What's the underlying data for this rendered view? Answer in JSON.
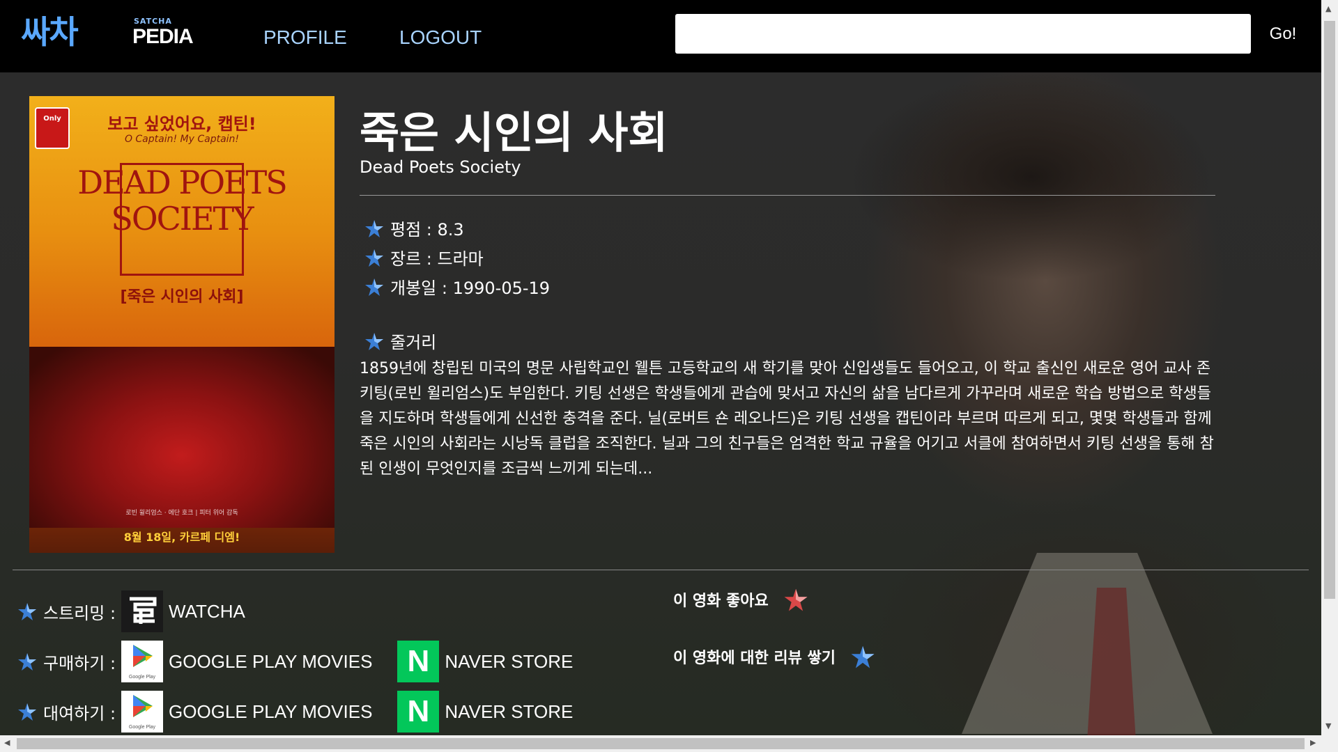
{
  "nav": {
    "logo_main": "싸차",
    "logo_small": "SATCHA",
    "logo_pedia": "PEDIA",
    "profile_label": "PROFILE",
    "logout_label": "LOGOUT",
    "search_value": "",
    "go_label": "Go!"
  },
  "poster": {
    "tag": "Only",
    "line1": "보고 싶었어요, 캡틴!",
    "line2": "O Captain! My Captain!",
    "title": "DEAD POETS SOCIETY",
    "subtitle": "[죽은 시인의 사회]",
    "credits": "로빈 윌리엄스 · 에단 호크 | 피터 위어 감독",
    "bottom": "8월 18일, 카르페 디엠!"
  },
  "movie": {
    "title_ko": "죽은 시인의 사회",
    "title_en": "Dead Poets Society",
    "rating": "평점 : 8.3",
    "genre": "장르 : 드라마",
    "release": "개봉일 : 1990-05-19",
    "plot_label": "줄거리",
    "plot": "1859년에 창립된 미국의 명문 사립학교인 웰튼 고등학교의 새 학기를 맞아 신입생들도 들어오고, 이 학교 출신인 새로운 영어 교사 존 키팅(로빈 윌리엄스)도 부임한다. 키팅 선생은 학생들에게 관습에 맞서고 자신의 삶을 남다르게 가꾸라며 새로운 학습 방법으로 학생들을 지도하며 학생들에게 신선한 충격을 준다. 닐(로버트 숀 레오나드)은 키팅 선생을 캡틴이라 부르며 따르게 되고, 몇몇 학생들과 함께 죽은 시인의 사회라는 시낭독 클럽을 조직한다. 닐과 그의 친구들은 엄격한 학교 규율을 어기고 서클에 참여하면서 키팅 선생을 통해 참된 인생이 무엇인지를 조금씩 느끼게 되는데..."
  },
  "links": {
    "streaming_label": "스트리밍 :",
    "buy_label": "구매하기 :",
    "rent_label": "대여하기 :",
    "watcha": "WATCHA",
    "gplay": "GOOGLE PLAY MOVIES",
    "gplay_icon_text": "Google Play",
    "naver": "NAVER STORE",
    "naver_icon": "N"
  },
  "actions": {
    "like": "이 영화 좋아요",
    "review": "이 영화에 대한 리뷰 쌓기"
  },
  "colors": {
    "star_blue": "#3b7fd6",
    "star_red": "#d94848",
    "nav_link": "#a9d4ff",
    "naver_green": "#03c75a"
  }
}
